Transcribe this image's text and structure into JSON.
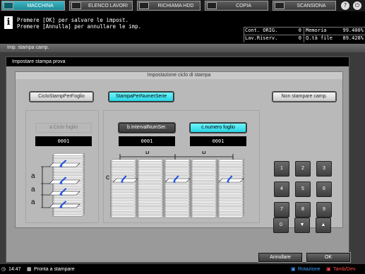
{
  "tabs": [
    {
      "label": "MACCHINA",
      "icon": "machine-icon",
      "active": true
    },
    {
      "label": "ELENCO LAVORI",
      "icon": "job-list-icon",
      "active": false
    },
    {
      "label": "RICHIAMA HDD",
      "icon": "hdd-icon",
      "active": false
    },
    {
      "label": "COPIA",
      "icon": "copy-icon",
      "active": false
    },
    {
      "label": "SCANSIONA",
      "icon": "scan-icon",
      "active": false
    }
  ],
  "top_icons": {
    "help": "?",
    "power": "⏻"
  },
  "message": {
    "line1": "Premere [OK] per salvare le impost.",
    "line2": "Premere [Annulla] per annullare le imp."
  },
  "counters": {
    "cont_orig_label": "Cont. ORIG.",
    "cont_orig_value": "0",
    "memoria_label": "Memoria",
    "memoria_value": "99.400%",
    "lav_riserv_label": "Lav.Riserv.",
    "lav_riserv_value": "0",
    "qta_file_label": "Q.tà file",
    "qta_file_value": "89.428%"
  },
  "window_title": "Imp. stampa camp.",
  "panel_title": "Impostare stampa prova",
  "section_title": "Impostazione ciclo di stampa",
  "mode_buttons": {
    "ciclo": "CicloStampPerFoglio",
    "numer": "StampaPerNumerSerie",
    "non_stampare": "Non stampare camp."
  },
  "fields": {
    "a_label": "a.Ciclo foglio",
    "a_value": "0001",
    "b_label": "b.IntervalNumSer.",
    "b_value": "0001",
    "c_label": "c.numero foglio",
    "c_value": "0001"
  },
  "diagram_labels": {
    "a": "a",
    "b": "b",
    "c": "c"
  },
  "keypad": [
    "1",
    "2",
    "3",
    "4",
    "5",
    "6",
    "7",
    "8",
    "9",
    "0",
    "▼",
    "▲"
  ],
  "footer": {
    "annulla": "Annullare",
    "ok": "OK"
  },
  "status": {
    "time": "14:47",
    "ready": "Pronta a stampare",
    "rotation": "Rotazione",
    "tamb": "Tamb/Dev"
  }
}
